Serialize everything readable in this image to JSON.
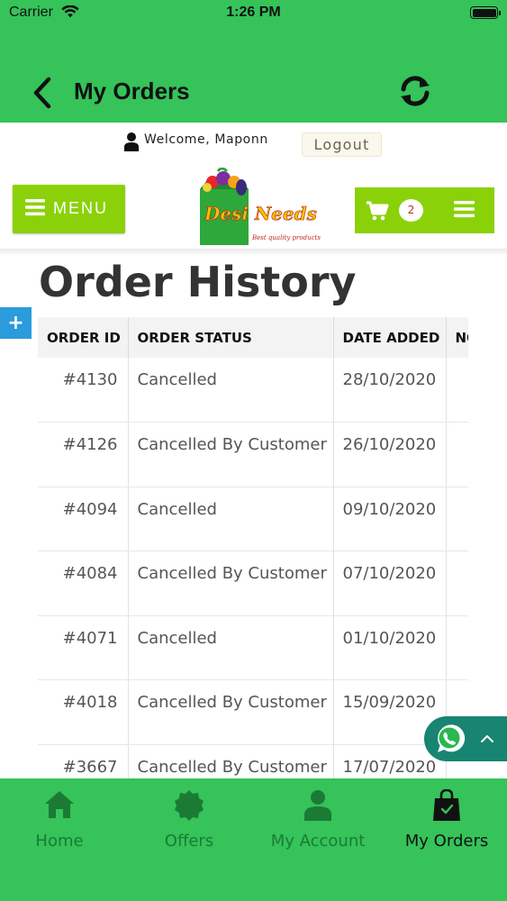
{
  "status_bar": {
    "carrier": "Carrier",
    "time": "1:26 PM"
  },
  "nav": {
    "title": "My Orders"
  },
  "header": {
    "welcome": "Welcome, Maponn",
    "logout": "Logout",
    "menu": "MENU",
    "logo_text": "Desi Needs",
    "logo_tagline": "Best quality products",
    "cart_count": "2"
  },
  "main": {
    "title": "Order History",
    "side_button": "+",
    "columns": [
      "ORDER ID",
      "ORDER STATUS",
      "DATE ADDED",
      "NO"
    ],
    "orders": [
      {
        "id": "#4130",
        "status": "Cancelled",
        "date": "28/10/2020"
      },
      {
        "id": "#4126",
        "status": "Cancelled By Customer",
        "date": "26/10/2020"
      },
      {
        "id": "#4094",
        "status": "Cancelled",
        "date": "09/10/2020"
      },
      {
        "id": "#4084",
        "status": "Cancelled By Customer",
        "date": "07/10/2020"
      },
      {
        "id": "#4071",
        "status": "Cancelled",
        "date": "01/10/2020"
      },
      {
        "id": "#4018",
        "status": "Cancelled By Customer",
        "date": "15/09/2020"
      },
      {
        "id": "#3667",
        "status": "Cancelled By Customer",
        "date": "17/07/2020"
      }
    ]
  },
  "tabbar": {
    "items": [
      {
        "label": "Home",
        "icon": "home-icon"
      },
      {
        "label": "Offers",
        "icon": "offer-badge-icon"
      },
      {
        "label": "My Account",
        "icon": "person-icon"
      },
      {
        "label": "My Orders",
        "icon": "shopping-bag-icon",
        "active": true
      }
    ]
  },
  "colors": {
    "app_green": "#35c35a",
    "lime_button": "#8bd10a",
    "whatsapp_teal": "#178571",
    "side_button_blue": "#2a9bdb",
    "tab_inactive": "#1b7b34"
  }
}
